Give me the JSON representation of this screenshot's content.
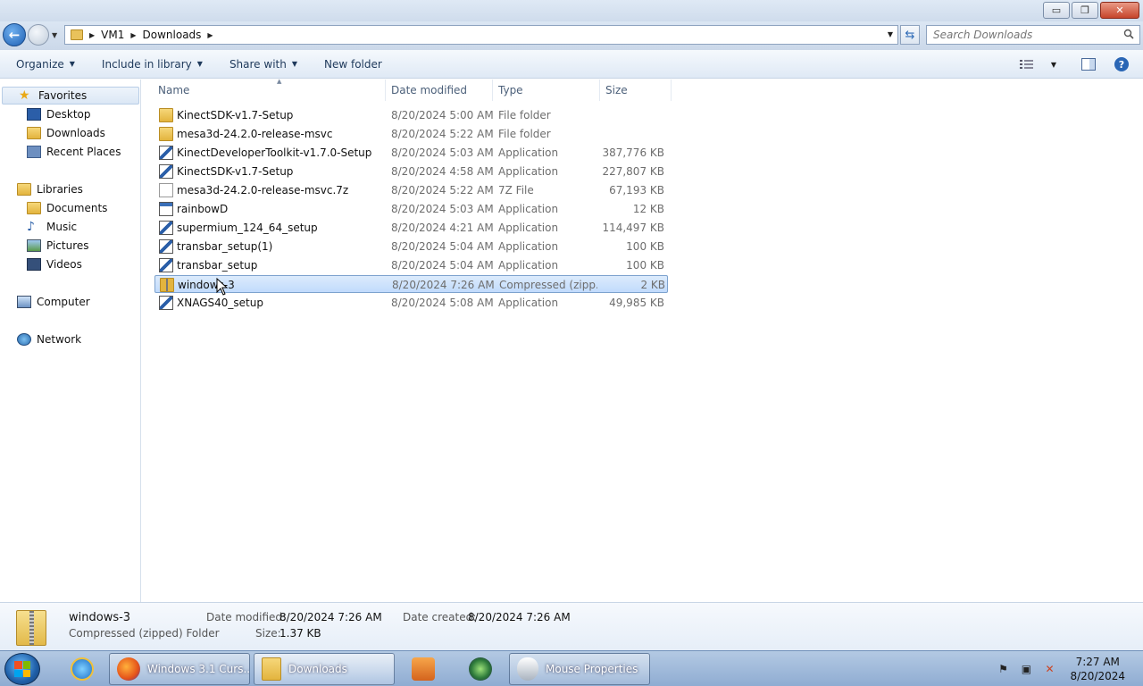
{
  "window": {
    "buttons": {
      "minimize": "▭",
      "maximize": "❐",
      "close": "✕"
    }
  },
  "address": {
    "crumbs": [
      "VM1",
      "Downloads"
    ],
    "search_placeholder": "Search Downloads"
  },
  "toolbar": {
    "organize": "Organize",
    "include_in_library": "Include in library",
    "share_with": "Share with",
    "new_folder": "New folder"
  },
  "nav": {
    "favorites": "Favorites",
    "desktop": "Desktop",
    "downloads": "Downloads",
    "recent_places": "Recent Places",
    "libraries": "Libraries",
    "documents": "Documents",
    "music": "Music",
    "pictures": "Pictures",
    "videos": "Videos",
    "computer": "Computer",
    "network": "Network"
  },
  "columns": {
    "name": "Name",
    "date": "Date modified",
    "type": "Type",
    "size": "Size"
  },
  "files": [
    {
      "name": "KinectSDK-v1.7-Setup",
      "date": "8/20/2024 5:00 AM",
      "type": "File folder",
      "size": "",
      "icon": "folder-icon"
    },
    {
      "name": "mesa3d-24.2.0-release-msvc",
      "date": "8/20/2024 5:22 AM",
      "type": "File folder",
      "size": "",
      "icon": "folder-icon"
    },
    {
      "name": "KinectDeveloperToolkit-v1.7.0-Setup",
      "date": "8/20/2024 5:03 AM",
      "type": "Application",
      "size": "387,776 KB",
      "icon": "installer-icon"
    },
    {
      "name": "KinectSDK-v1.7-Setup",
      "date": "8/20/2024 4:58 AM",
      "type": "Application",
      "size": "227,807 KB",
      "icon": "installer-icon"
    },
    {
      "name": "mesa3d-24.2.0-release-msvc.7z",
      "date": "8/20/2024 5:22 AM",
      "type": "7Z File",
      "size": "67,193 KB",
      "icon": "file-icon"
    },
    {
      "name": "rainbowD",
      "date": "8/20/2024 5:03 AM",
      "type": "Application",
      "size": "12 KB",
      "icon": "application-icon"
    },
    {
      "name": "supermium_124_64_setup",
      "date": "8/20/2024 4:21 AM",
      "type": "Application",
      "size": "114,497 KB",
      "icon": "installer-icon"
    },
    {
      "name": "transbar_setup(1)",
      "date": "8/20/2024 5:04 AM",
      "type": "Application",
      "size": "100 KB",
      "icon": "installer-icon"
    },
    {
      "name": "transbar_setup",
      "date": "8/20/2024 5:04 AM",
      "type": "Application",
      "size": "100 KB",
      "icon": "installer-icon"
    },
    {
      "name": "windows-3",
      "date": "8/20/2024 7:26 AM",
      "type": "Compressed (zipp...",
      "size": "2 KB",
      "icon": "zip-folder-icon",
      "selected": true
    },
    {
      "name": "XNAGS40_setup",
      "date": "8/20/2024 5:08 AM",
      "type": "Application",
      "size": "49,985 KB",
      "icon": "installer-icon"
    }
  ],
  "details": {
    "name": "windows-3",
    "kind": "Compressed (zipped) Folder",
    "date_modified_label": "Date modified:",
    "date_modified": "8/20/2024 7:26 AM",
    "date_created_label": "Date created:",
    "date_created": "8/20/2024 7:26 AM",
    "size_label": "Size:",
    "size": "1.37 KB"
  },
  "taskbar": {
    "firefox_title": "Windows 3.1 Curs...",
    "explorer_title": "Downloads",
    "mouse_title": "Mouse Properties",
    "time": "7:27 AM",
    "date": "8/20/2024"
  }
}
